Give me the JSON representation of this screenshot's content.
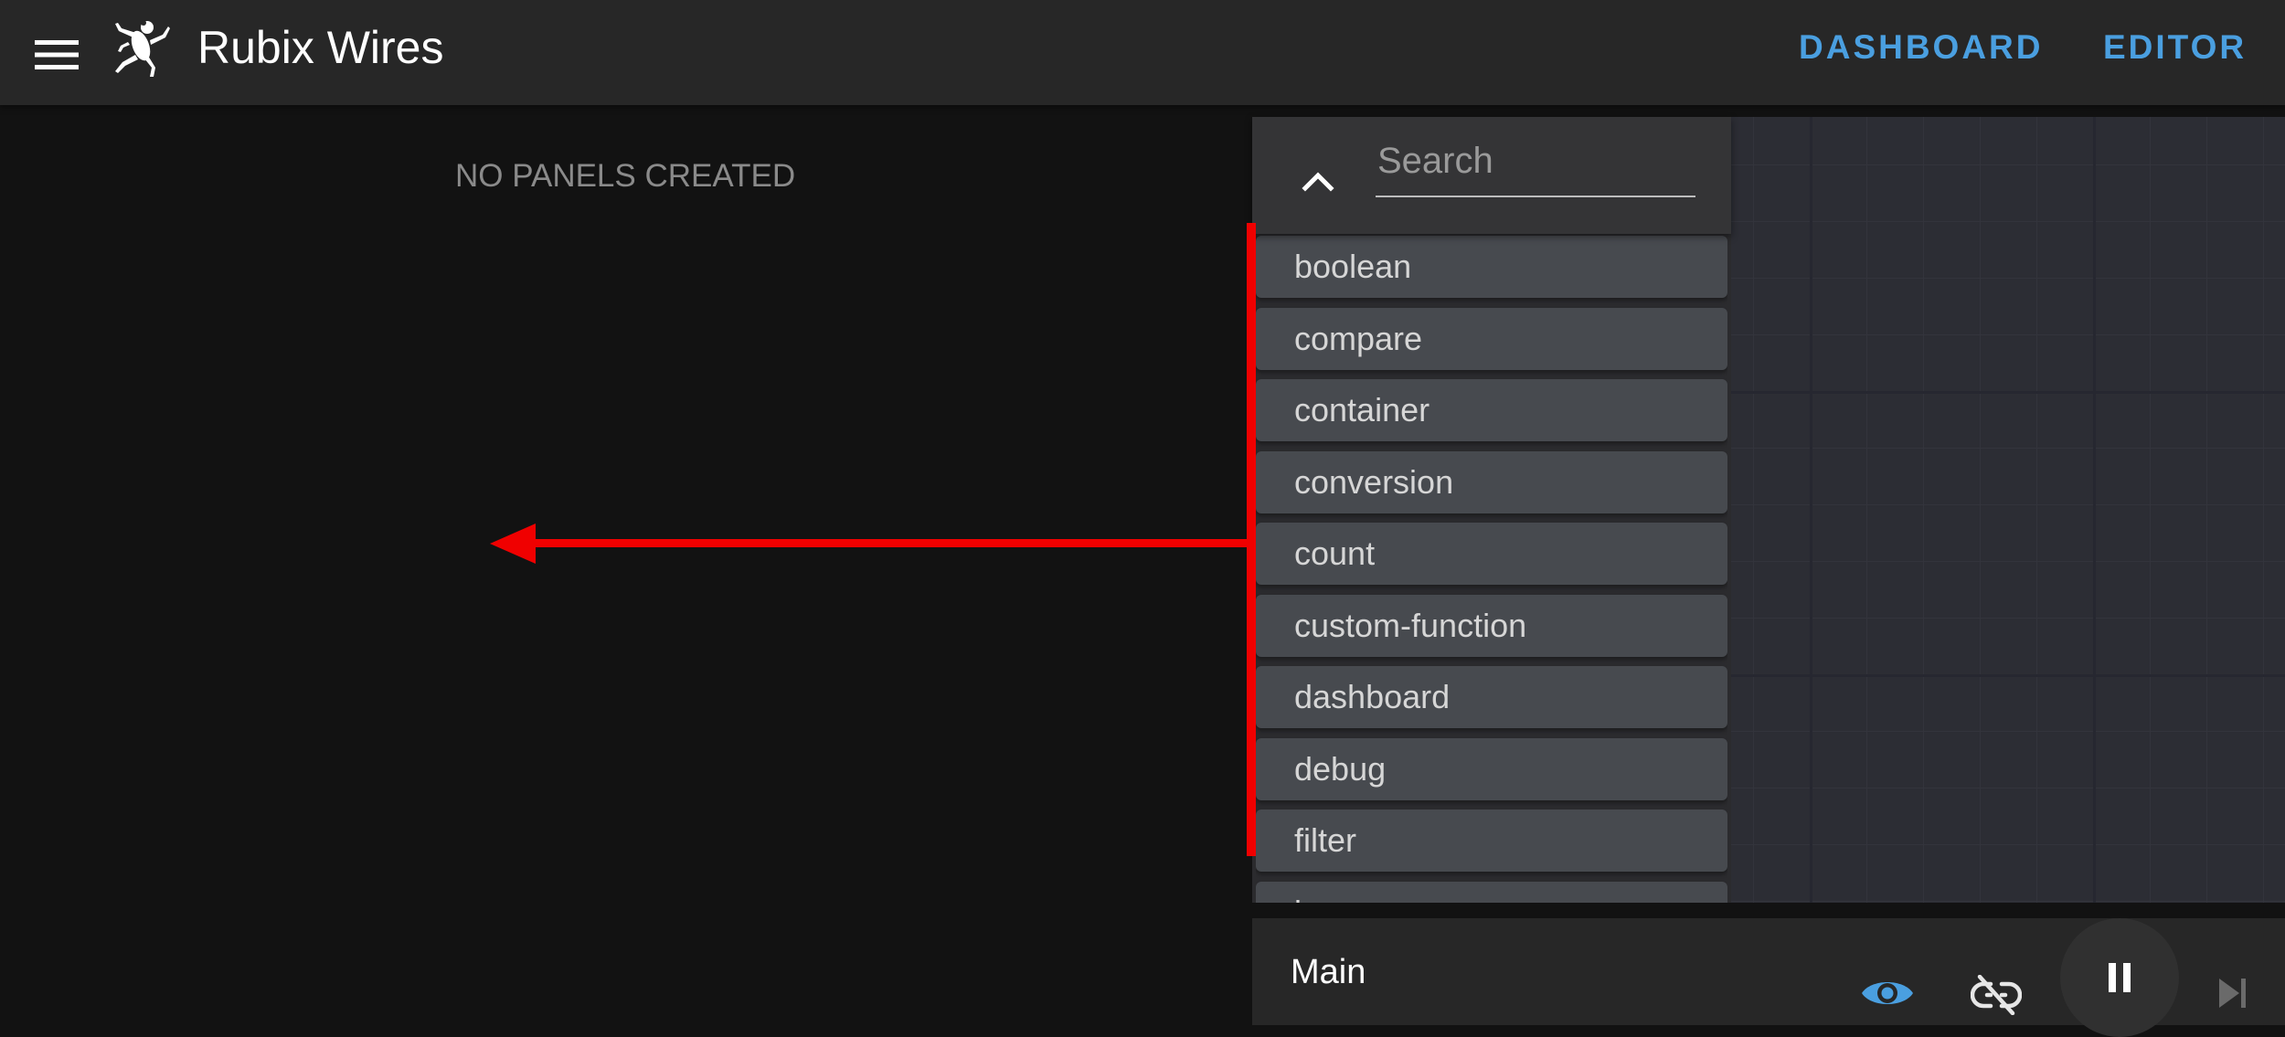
{
  "header": {
    "title": "Rubix Wires",
    "nav": [
      {
        "label": "DASHBOARD"
      },
      {
        "label": "EDITOR"
      }
    ]
  },
  "dashboard": {
    "empty_message": "NO PANELS CREATED"
  },
  "node_panel": {
    "search_placeholder": "Search",
    "items": [
      {
        "label": "boolean"
      },
      {
        "label": "compare"
      },
      {
        "label": "container"
      },
      {
        "label": "conversion"
      },
      {
        "label": "count"
      },
      {
        "label": "custom-function"
      },
      {
        "label": "dashboard"
      },
      {
        "label": "debug"
      },
      {
        "label": "filter"
      },
      {
        "label": "l..."
      }
    ]
  },
  "bottom_bar": {
    "flow_name": "Main"
  },
  "icons": {
    "menu": "menu-icon",
    "logo": "frog-logo",
    "collapse": "chevron-up-icon",
    "eye": "eye-icon",
    "unlink": "link-off-icon",
    "pause": "pause-icon",
    "step": "skip-next-icon"
  },
  "colors": {
    "accent": "#4a9fe0",
    "annotation": "#f00000",
    "appbar": "#272727",
    "background": "#121212",
    "node_item": "#474a4f"
  }
}
